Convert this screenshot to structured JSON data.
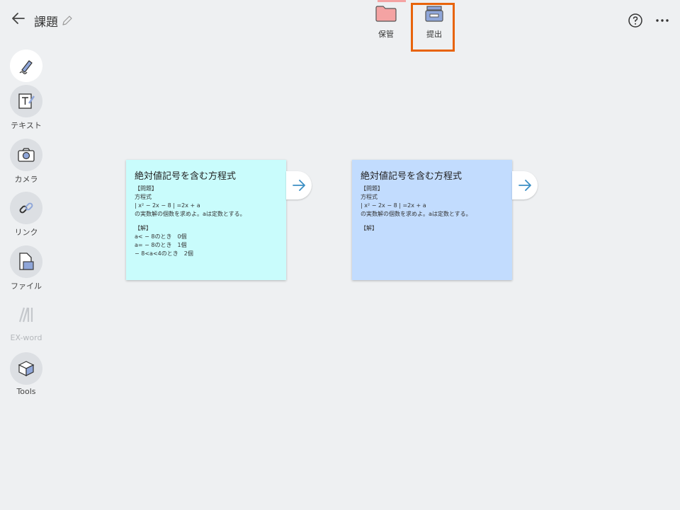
{
  "header": {
    "title": "課題",
    "keep_label": "保管",
    "submit_label": "提出"
  },
  "sidebar": {
    "items": [
      {
        "label": "",
        "icon": "pen-icon"
      },
      {
        "label": "テキスト",
        "icon": "text-icon"
      },
      {
        "label": "カメラ",
        "icon": "camera-icon"
      },
      {
        "label": "リンク",
        "icon": "link-icon"
      },
      {
        "label": "ファイル",
        "icon": "file-icon"
      },
      {
        "label": "EX-word",
        "icon": "dictionary-icon"
      },
      {
        "label": "Tools",
        "icon": "toolbox-icon"
      }
    ]
  },
  "cards": [
    {
      "title": "絶対値記号を含む方程式",
      "lines": [
        "【問題】",
        "方程式",
        "| x² − 2x − 8 | =2x + a",
        "の実数解の個数を求めよ。aは定数とする。"
      ],
      "answer_lines": [
        "【解】",
        "a< − 8のとき　0個",
        "a= − 8のとき　1個",
        " − 8<a<4のとき　2個"
      ],
      "color": "#c9fcfc"
    },
    {
      "title": "絶対値記号を含む方程式",
      "lines": [
        "【問題】",
        "方程式",
        "| x² − 2x − 8 | =2x + a",
        "の実数解の個数を求めよ。aは定数とする。"
      ],
      "answer_lines": [
        "【解】"
      ],
      "color": "#c2dcfe"
    }
  ],
  "colors": {
    "highlight": "#e8640c",
    "keep_folder": "#f4a3a3",
    "submit_tray": "#8fa6d9"
  }
}
